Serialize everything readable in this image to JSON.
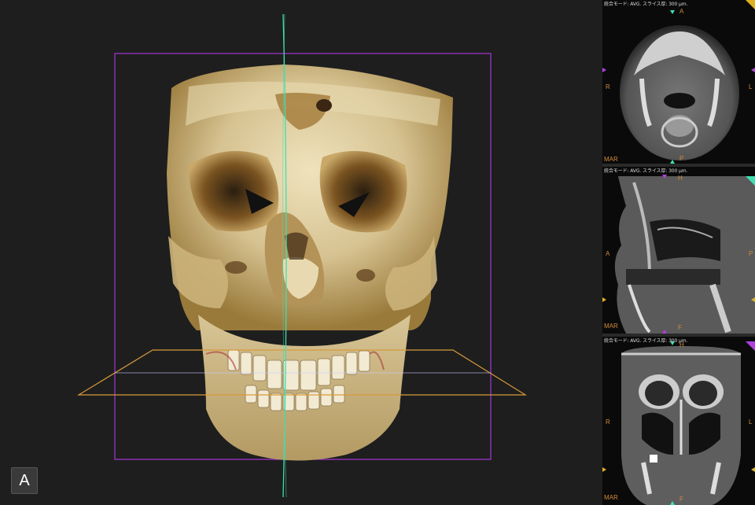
{
  "main_view": {
    "orientation_label": "A"
  },
  "panels": [
    {
      "name": "axial",
      "mode_text": "統合モード: AVG. スライス厚: 300 µm.",
      "top": "A",
      "bottom": "P",
      "left": "R",
      "right": "L",
      "corner": "MAR"
    },
    {
      "name": "sagittal",
      "mode_text": "統合モード: AVG. スライス厚: 300 µm.",
      "top": "H",
      "bottom": "F",
      "left": "A",
      "right": "P",
      "corner": "MAR"
    },
    {
      "name": "coronal",
      "mode_text": "統合モード: AVG. スライス厚: 300 µm.",
      "top": "H",
      "bottom": "F",
      "left": "R",
      "right": "L",
      "corner": "MAR"
    }
  ],
  "colors": {
    "axial_plane": "#e0a040",
    "sagittal_plane": "#40e0b0",
    "coronal_plane": "#b040e0",
    "bone": "#d9c89a",
    "bone_shadow": "#8a6a2a"
  }
}
